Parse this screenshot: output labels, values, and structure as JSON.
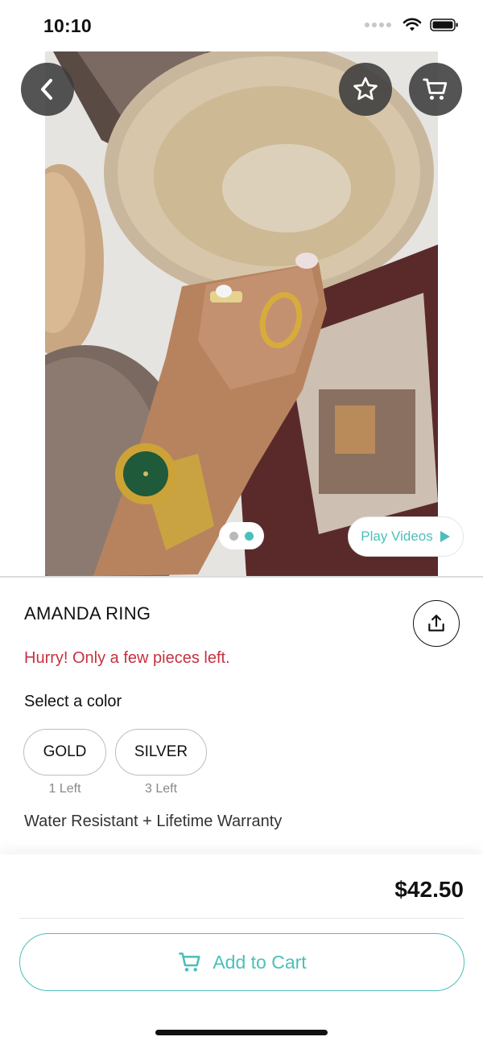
{
  "status_bar": {
    "time": "10:10"
  },
  "hero": {
    "pager": {
      "total": 2,
      "active_index": 1
    },
    "play_videos_label": "Play Videos"
  },
  "product": {
    "name": "AMANDA RING",
    "stock_warning": "Hurry! Only a few pieces left.",
    "select_color_label": "Select a color",
    "colors": [
      {
        "label": "GOLD",
        "stock": "1 Left"
      },
      {
        "label": "SILVER",
        "stock": "3 Left"
      }
    ],
    "features": "Water Resistant + Lifetime Warranty"
  },
  "checkout": {
    "price": "$42.50",
    "add_to_cart_label": "Add to Cart"
  },
  "icons": {
    "back": "chevron-left-icon",
    "favorite": "star-icon",
    "cart": "cart-icon",
    "share": "share-icon",
    "play": "play-icon"
  },
  "colors": {
    "accent": "#4bbfb9",
    "warning": "#c8313f",
    "pager_inactive": "#b9b9b9",
    "overlay_button": "#3c3c3c"
  }
}
